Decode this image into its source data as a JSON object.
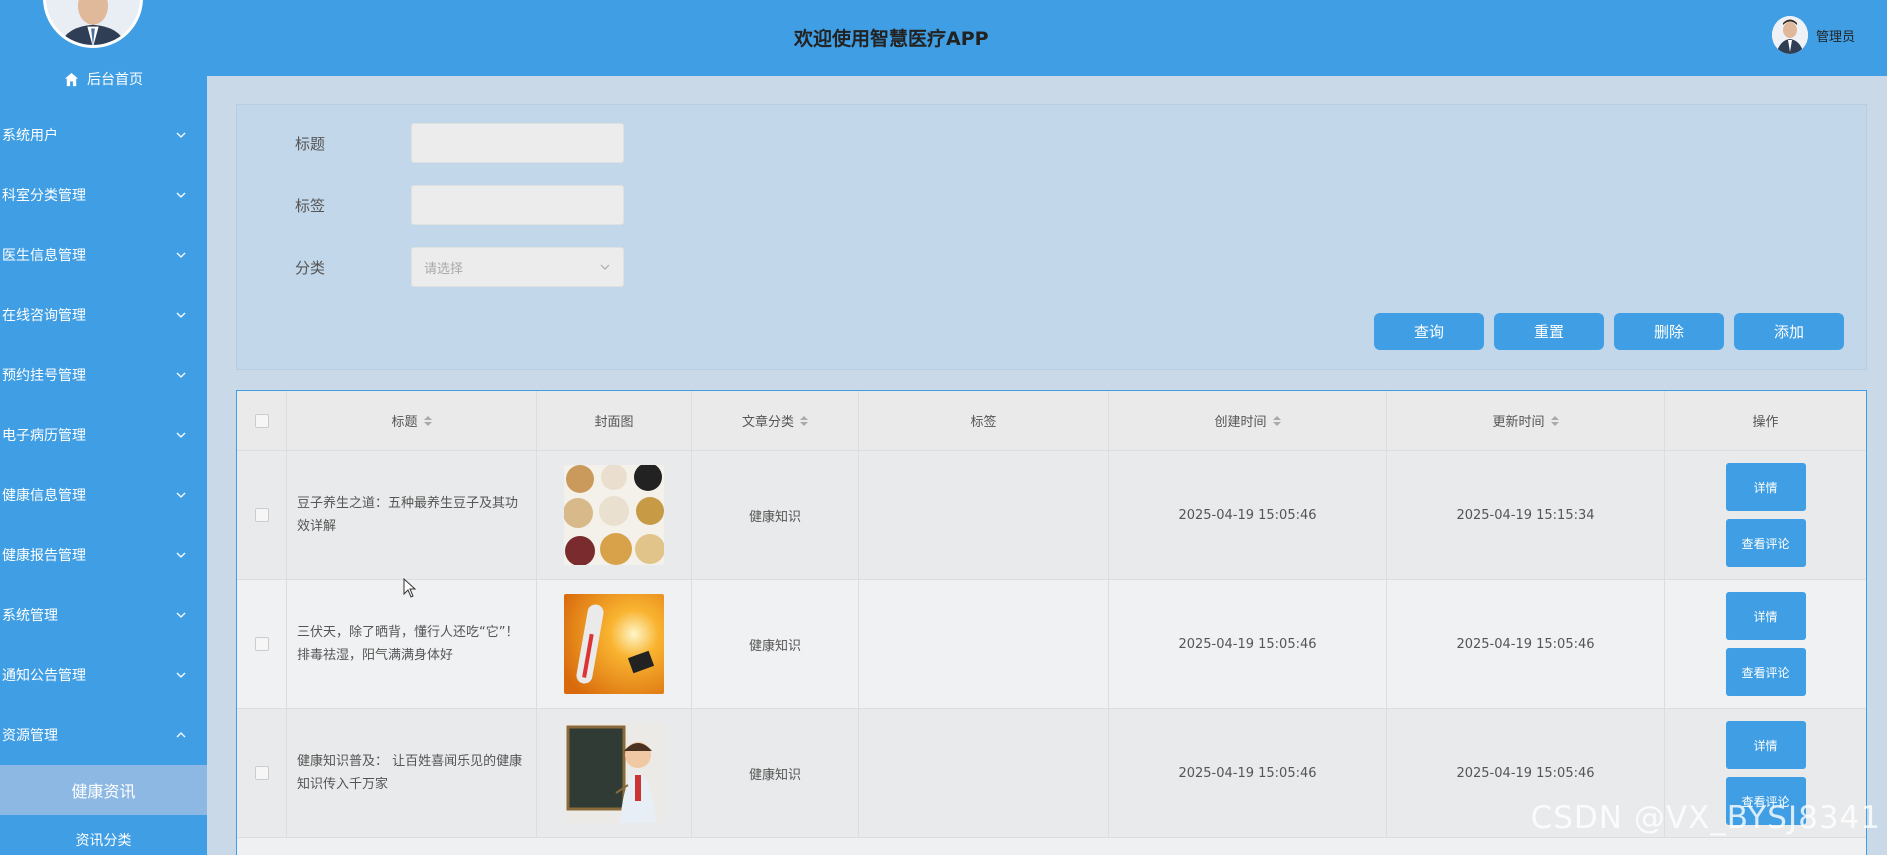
{
  "sidebar": {
    "home_label": "后台首页",
    "menu": [
      {
        "label": "系统用户",
        "expanded": false
      },
      {
        "label": "科室分类管理",
        "expanded": false
      },
      {
        "label": "医生信息管理",
        "expanded": false
      },
      {
        "label": "在线咨询管理",
        "expanded": false
      },
      {
        "label": "预约挂号管理",
        "expanded": false
      },
      {
        "label": "电子病历管理",
        "expanded": false
      },
      {
        "label": "健康信息管理",
        "expanded": false
      },
      {
        "label": "健康报告管理",
        "expanded": false
      },
      {
        "label": "系统管理",
        "expanded": false
      },
      {
        "label": "通知公告管理",
        "expanded": false
      },
      {
        "label": "资源管理",
        "expanded": true
      }
    ],
    "submenu": {
      "active": "健康资讯",
      "next": "资讯分类"
    }
  },
  "header": {
    "title": "欢迎使用智慧医疗APP",
    "user": "管理员"
  },
  "search": {
    "title_label": "标题",
    "tag_label": "标签",
    "category_label": "分类",
    "category_placeholder": "请选择",
    "buttons": {
      "query": "查询",
      "reset": "重置",
      "delete": "删除",
      "add": "添加"
    }
  },
  "table": {
    "headers": {
      "title": "标题",
      "cover": "封面图",
      "category": "文章分类",
      "tag": "标签",
      "created": "创建时间",
      "updated": "更新时间",
      "ops": "操作"
    },
    "rows": [
      {
        "title": "豆子养生之道：五种最养生豆子及其功效详解",
        "category": "健康知识",
        "tag": "",
        "created": "2025-04-19 15:05:46",
        "updated": "2025-04-19 15:15:34",
        "cover": "beans"
      },
      {
        "title": "三伏天，除了晒背，懂行人还吃“它”！排毒祛湿，阳气满满身体好",
        "category": "健康知识",
        "tag": "",
        "created": "2025-04-19 15:05:46",
        "updated": "2025-04-19 15:05:46",
        "cover": "thermometer"
      },
      {
        "title": "健康知识普及： 让百姓喜闻乐见的健康知识传入千万家",
        "category": "健康知识",
        "tag": "",
        "created": "2025-04-19 15:05:46",
        "updated": "2025-04-19 15:05:46",
        "cover": "lecture"
      }
    ],
    "op_labels": {
      "detail": "详情",
      "comments": "查看评论"
    }
  },
  "watermark": "CSDN @VX_BYSJ8341",
  "colors": {
    "primary": "#409fe4",
    "panel": "#c3d7ea"
  }
}
